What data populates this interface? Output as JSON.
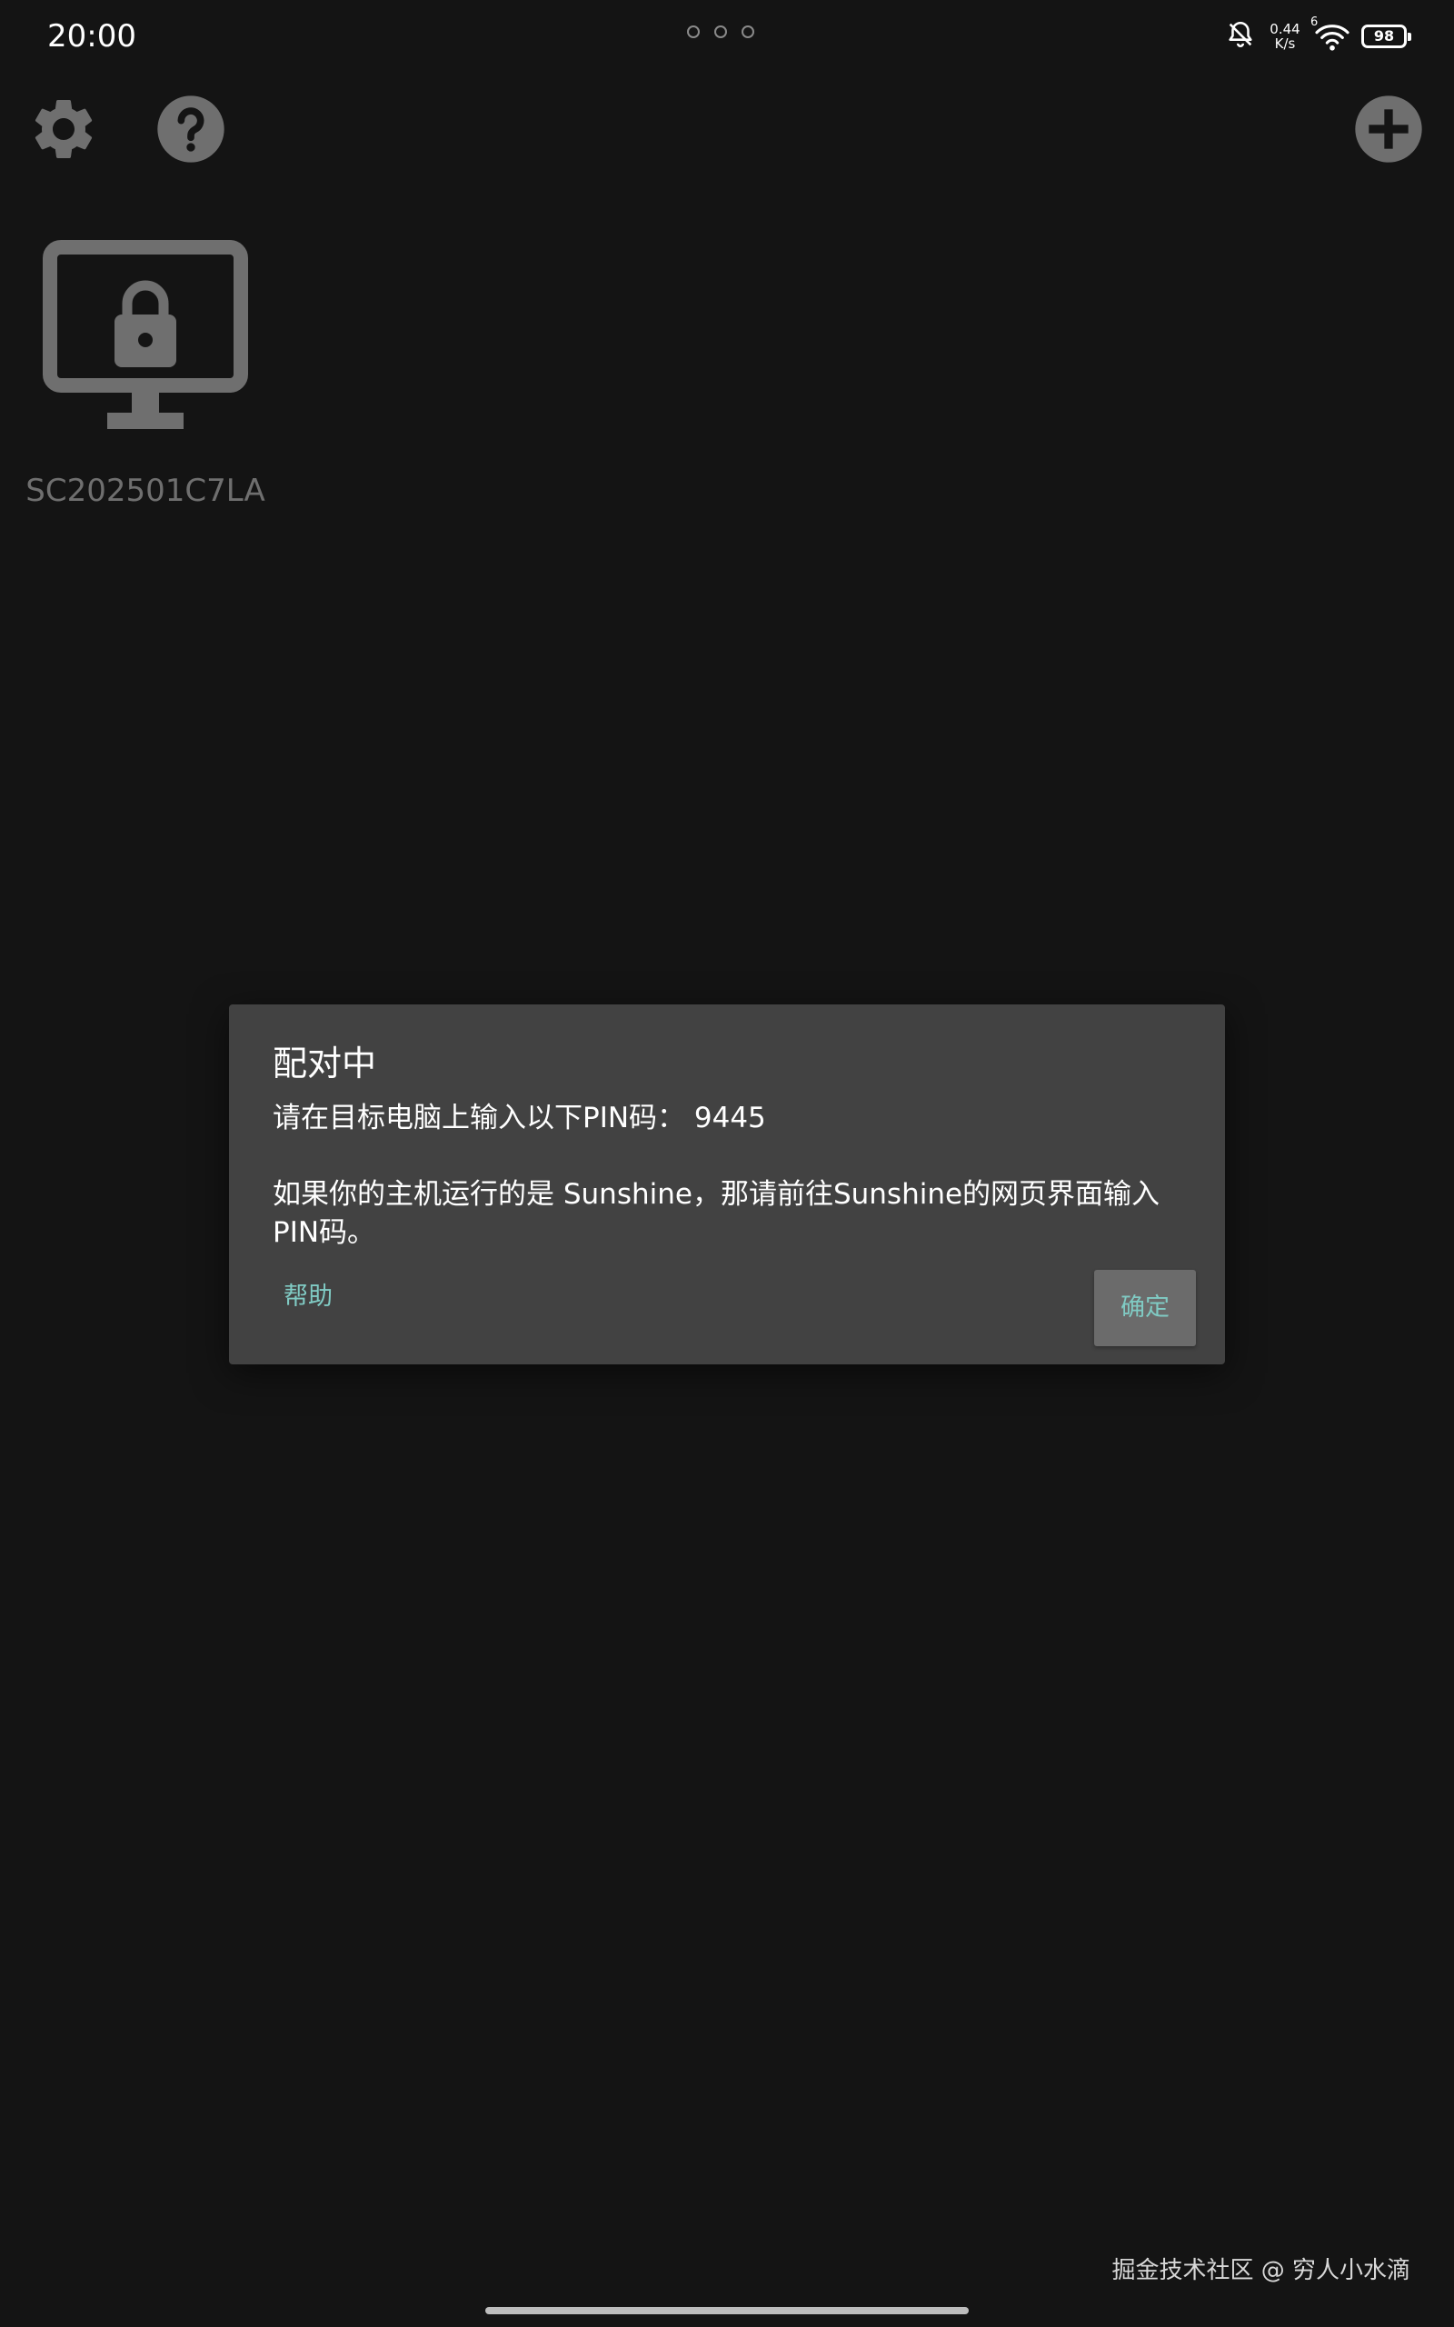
{
  "status_bar": {
    "time": "20:00",
    "net_speed_value": "0.44",
    "net_speed_unit": "K/s",
    "wifi_badge": "6",
    "battery_level": "98"
  },
  "toolbar": {
    "settings_icon": "gear-icon",
    "help_icon": "question-icon",
    "add_icon": "plus-icon"
  },
  "pc_list": [
    {
      "name": "SC202501C7LA",
      "icon": "locked-monitor-icon"
    }
  ],
  "dialog": {
    "title": "配对中",
    "message": "请在目标电脑上输入以下PIN码： 9445\n\n如果你的主机运行的是 Sunshine，那请前往Sunshine的网页界面输入PIN码。",
    "help_label": "帮助",
    "ok_label": "确定"
  },
  "watermark": "掘金技术社区 @ 穷人小水滴",
  "colors": {
    "background": "#141414",
    "dialog_background": "#424242",
    "accent": "#80cbc4",
    "icon_gray": "#6f6f6f"
  }
}
